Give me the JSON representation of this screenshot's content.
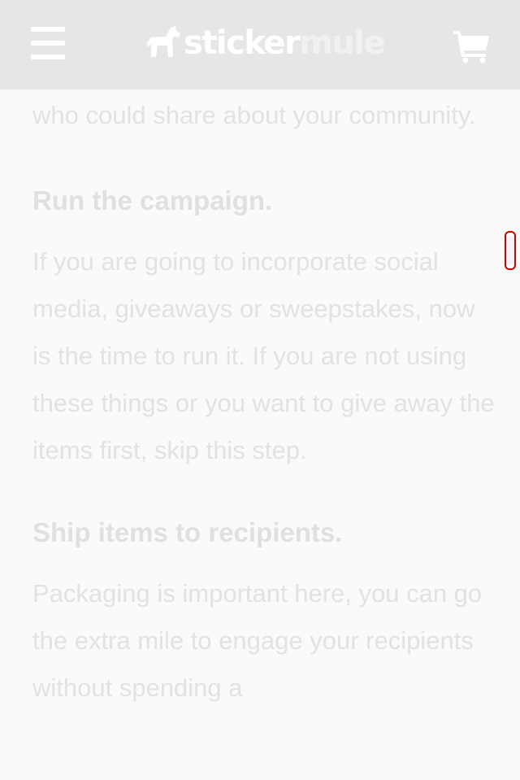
{
  "header": {
    "logo_part1": "sticker",
    "logo_part2": "mule",
    "menu_icon": "hamburger-menu-icon",
    "cart_icon": "shopping-cart-icon",
    "logo_icon": "mule-icon",
    "background_color": "#e6e6e6"
  },
  "article": {
    "text_color": "#e2e2e2",
    "paragraph_1": "who could share about your community.",
    "heading_1": "Run the campaign.",
    "paragraph_2": "If you are going to incorporate social media, giveaways or sweepstakes, now is the time to run it. If you are not using these things or you want to give away the items first, skip this step.",
    "heading_2": "Ship items to recipients.",
    "paragraph_3": "Packaging is important here, you can go the extra mile to engage your recipients without spending a"
  },
  "side_tab": {
    "accent_color": "#d40000"
  }
}
